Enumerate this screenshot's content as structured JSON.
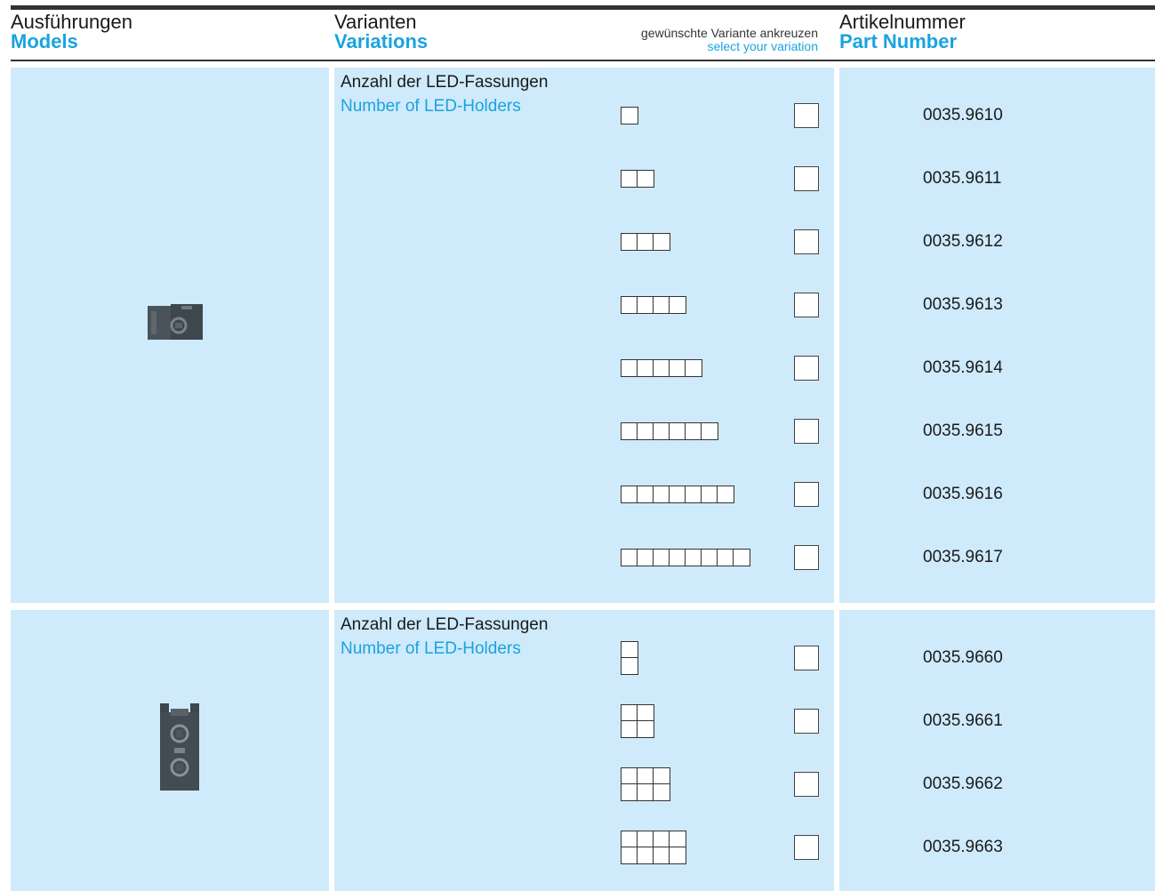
{
  "header": {
    "models_de": "Ausführungen",
    "models_en": "Models",
    "variations_de": "Varianten",
    "variations_en": "Variations",
    "select_de": "gewünschte Variante ankreuzen",
    "select_en": "select your variation",
    "part_de": "Artikelnummer",
    "part_en": "Part Number"
  },
  "colors": {
    "accent": "#1aa3e0",
    "panel": "#cfeafb",
    "rule": "#333333"
  },
  "groups": [
    {
      "label_de": "Anzahl der LED-Fassungen",
      "label_en": "Number of LED-Holders",
      "image": "single-row LED holder",
      "rows": [
        {
          "part": "0035.9610",
          "cols": 1,
          "rows": 1
        },
        {
          "part": "0035.9611",
          "cols": 2,
          "rows": 1
        },
        {
          "part": "0035.9612",
          "cols": 3,
          "rows": 1
        },
        {
          "part": "0035.9613",
          "cols": 4,
          "rows": 1
        },
        {
          "part": "0035.9614",
          "cols": 5,
          "rows": 1
        },
        {
          "part": "0035.9615",
          "cols": 6,
          "rows": 1
        },
        {
          "part": "0035.9616",
          "cols": 7,
          "rows": 1
        },
        {
          "part": "0035.9617",
          "cols": 8,
          "rows": 1
        }
      ]
    },
    {
      "label_de": "Anzahl der LED-Fassungen",
      "label_en": "Number of LED-Holders",
      "image": "double-row LED holder",
      "rows": [
        {
          "part": "0035.9660",
          "cols": 1,
          "rows": 2
        },
        {
          "part": "0035.9661",
          "cols": 2,
          "rows": 2
        },
        {
          "part": "0035.9662",
          "cols": 3,
          "rows": 2
        },
        {
          "part": "0035.9663",
          "cols": 4,
          "rows": 2
        }
      ]
    }
  ]
}
